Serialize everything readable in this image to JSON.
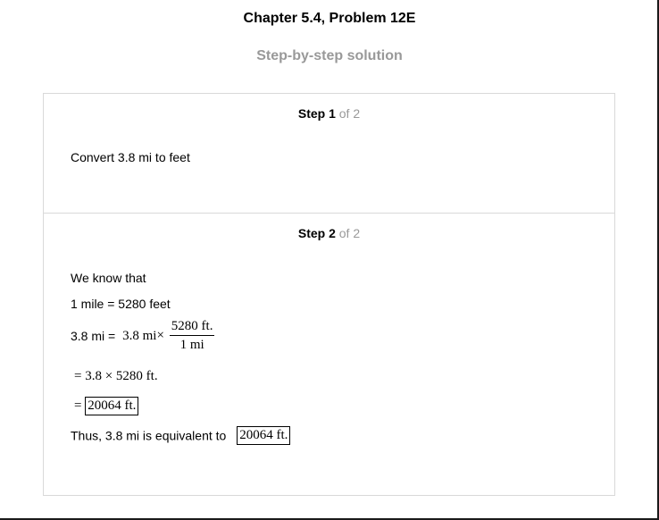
{
  "header": {
    "title": "Chapter 5.4, Problem 12E",
    "subtitle": "Step-by-step solution"
  },
  "steps": [
    {
      "label": "Step 1",
      "of": "of 2",
      "text": "Convert 3.8 mi to feet"
    },
    {
      "label": "Step 2",
      "of": "of 2",
      "we_know": "We know that",
      "fact": "1 mile = 5280 feet",
      "eq1_left": "3.8 mi = ",
      "eq1_factor": "3.8 mi",
      "times": "×",
      "frac_num": "5280 ft.",
      "frac_den": "1 mi",
      "eq2_eq": "=",
      "eq2": "3.8 × 5280 ft.",
      "eq3_eq": "=",
      "eq3_result": "20064 ft.",
      "conclusion": "Thus, 3.8 mi is equivalent to",
      "conclusion_result": "20064 ft."
    }
  ]
}
